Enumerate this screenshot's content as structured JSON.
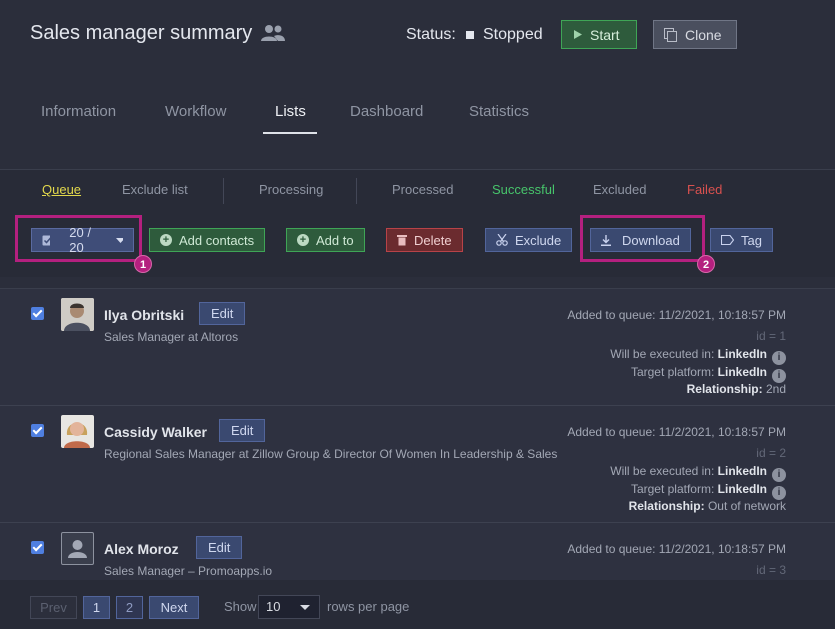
{
  "header": {
    "title": "Sales manager summary",
    "status_label": "Status:",
    "status_value": "Stopped",
    "start_label": "Start",
    "clone_label": "Clone"
  },
  "tabs": [
    "Information",
    "Workflow",
    "Lists",
    "Dashboard",
    "Statistics"
  ],
  "active_tab": "Lists",
  "subtabs": [
    "Queue",
    "Exclude list",
    "Processing",
    "Processed",
    "Successful",
    "Excluded",
    "Failed"
  ],
  "toolbar": {
    "select_count": "20 / 20",
    "add_contacts": "Add contacts",
    "add_to": "Add to",
    "delete": "Delete",
    "exclude": "Exclude",
    "download": "Download",
    "tag": "Tag",
    "badge1": "1",
    "badge2": "2"
  },
  "contacts": [
    {
      "name": "Ilya Obritski",
      "edit": "Edit",
      "headline": "Sales Manager at Altoros",
      "added": "Added to queue: 11/2/2021, 10:18:57 PM",
      "id": "id = 1",
      "executed_label": "Will be executed in:",
      "executed_value": "LinkedIn",
      "platform_label": "Target platform:",
      "platform_value": "LinkedIn",
      "relationship_label": "Relationship:",
      "relationship_value": "2nd"
    },
    {
      "name": "Cassidy Walker",
      "edit": "Edit",
      "headline": "Regional Sales Manager at Zillow Group & Director Of Women In Leadership & Sales",
      "added": "Added to queue: 11/2/2021, 10:18:57 PM",
      "id": "id = 2",
      "executed_label": "Will be executed in:",
      "executed_value": "LinkedIn",
      "platform_label": "Target platform:",
      "platform_value": "LinkedIn",
      "relationship_label": "Relationship:",
      "relationship_value": "Out of network"
    },
    {
      "name": "Alex Moroz",
      "edit": "Edit",
      "headline": "Sales Manager – Promoapps.io",
      "added": "Added to queue: 11/2/2021, 10:18:57 PM",
      "id": "id = 3"
    }
  ],
  "pager": {
    "prev": "Prev",
    "page1": "1",
    "page2": "2",
    "next": "Next",
    "show": "Show",
    "rows_value": "10",
    "per_page": "rows per page"
  },
  "icons": {
    "status": "stopped-square-icon",
    "start": "play-icon",
    "clone": "clone-icon",
    "title": "people-icon"
  }
}
